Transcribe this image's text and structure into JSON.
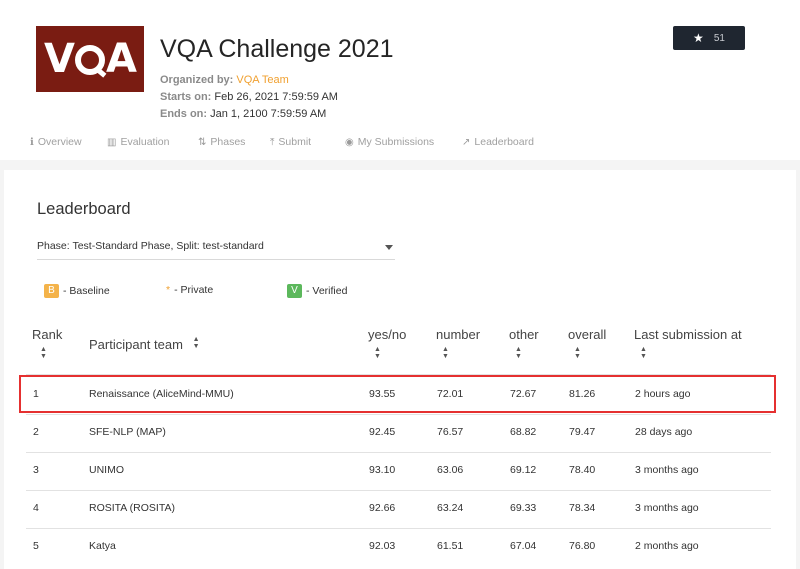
{
  "challenge": {
    "logo_text": "VQA",
    "title": "VQA Challenge 2021",
    "organized_by_label": "Organized by:",
    "organized_by": "VQA Team",
    "starts_label": "Starts on:",
    "starts": "Feb 26, 2021 7:59:59 AM",
    "ends_label": "Ends on:",
    "ends": "Jan 1, 2100 7:59:59 AM",
    "stars": "51",
    "tabs": [
      "Overview",
      "Evaluation",
      "Phases",
      "Submit",
      "My Submissions",
      "Leaderboard"
    ]
  },
  "leaderboard": {
    "title": "Leaderboard",
    "phase_label": "Phase:",
    "phase": "Test-Standard Phase",
    "split_label": "Split:",
    "split": "test-standard",
    "legend": {
      "baseline_badge": "B",
      "baseline": "- Baseline",
      "private_mark": "*",
      "private": "- Private",
      "verified_badge": "V",
      "verified": "- Verified"
    },
    "columns": [
      "Rank",
      "Participant team",
      "yes/no",
      "number",
      "other",
      "overall",
      "Last submission at"
    ],
    "rows": [
      [
        "1",
        "Renaissance (AliceMind-MMU)",
        "93.55",
        "72.01",
        "72.67",
        "81.26",
        "2 hours ago"
      ],
      [
        "2",
        "SFE-NLP (MAP)",
        "92.45",
        "76.57",
        "68.82",
        "79.47",
        "28 days ago"
      ],
      [
        "3",
        "UNIMO",
        "93.10",
        "63.06",
        "69.12",
        "78.40",
        "3 months ago"
      ],
      [
        "4",
        "ROSITA (ROSITA)",
        "92.66",
        "63.24",
        "69.33",
        "78.34",
        "3 months ago"
      ],
      [
        "5",
        "Katya",
        "92.03",
        "61.51",
        "67.04",
        "76.80",
        "2 months ago"
      ]
    ],
    "highlighted_row": 0
  },
  "icons": {
    "star": "star-icon",
    "overview": "info-icon",
    "evaluation": "bar-chart-icon",
    "phases": "sort-arrows-icon",
    "submit": "upload-icon",
    "my_submissions": "eye-icon",
    "leaderboard": "line-chart-icon",
    "sort": "sort-icon"
  },
  "colors": {
    "accent": "#f0a030",
    "logo_bg": "#7a1c12",
    "star_button": "#1f2630",
    "baseline": "#f4b34a",
    "verified": "#5cb85c",
    "highlight_box": "#e53030"
  }
}
